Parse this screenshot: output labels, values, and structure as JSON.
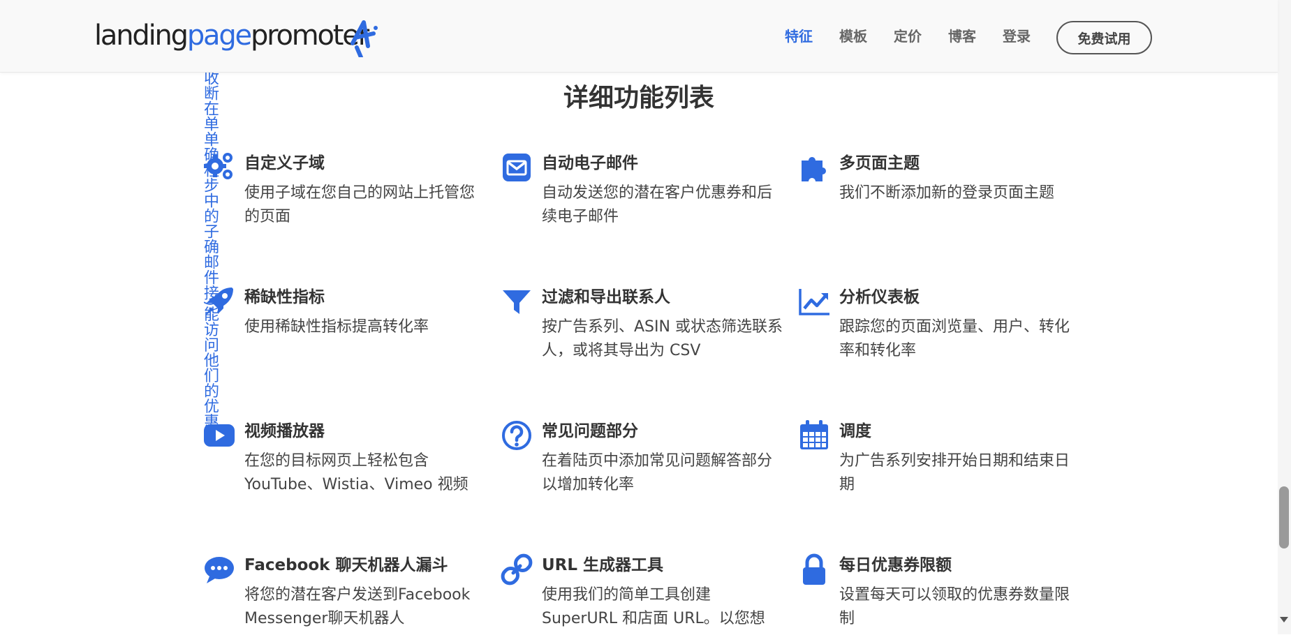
{
  "logo": {
    "part1": "landing",
    "part2": "page",
    "part3": "promoter"
  },
  "nav": [
    {
      "label": "特征",
      "active": true
    },
    {
      "label": "模板",
      "active": false
    },
    {
      "label": "定价",
      "active": false
    },
    {
      "label": "博客",
      "active": false
    },
    {
      "label": "登录",
      "active": false
    }
  ],
  "trial_button": "免费试用",
  "section_title": "详细功能列表",
  "overlap_text": "收断在单单确程步中的子确邮件接)能访问他们的优惠券",
  "features": [
    {
      "title": "自定义子域",
      "desc": "使用子域在您自己的网站上托管您的页面",
      "icon": "gears-icon"
    },
    {
      "title": "自动电子邮件",
      "desc": "自动发送您的潜在客户优惠券和后续电子邮件",
      "icon": "envelope-icon"
    },
    {
      "title": "多页面主题",
      "desc": "我们不断添加新的登录页面主题",
      "icon": "puzzle-icon"
    },
    {
      "title": "稀缺性指标",
      "desc": "使用稀缺性指标提高转化率",
      "icon": "rocket-icon"
    },
    {
      "title": "过滤和导出联系人",
      "desc": "按广告系列、ASIN 或状态筛选联系人，或将其导出为 CSV",
      "icon": "filter-icon"
    },
    {
      "title": "分析仪表板",
      "desc": "跟踪您的页面浏览量、用户、转化率和转化率",
      "icon": "chart-line-icon"
    },
    {
      "title": "视频播放器",
      "desc": "在您的目标网页上轻松包含 YouTube、Wistia、Vimeo 视频",
      "icon": "youtube-icon"
    },
    {
      "title": "常见问题部分",
      "desc": "在着陆页中添加常见问题解答部分以增加转化率",
      "icon": "question-circle-icon"
    },
    {
      "title": "调度",
      "desc": "为广告系列安排开始日期和结束日期",
      "icon": "calendar-icon"
    },
    {
      "title": "Facebook 聊天机器人漏斗",
      "desc": "将您的潜在客户发送到Facebook Messenger聊天机器人",
      "icon": "chat-icon"
    },
    {
      "title": "URL 生成器工具",
      "desc": "使用我们的简单工具创建 SuperURL 和店面 URL。以您想",
      "icon": "link-icon"
    },
    {
      "title": "每日优惠券限额",
      "desc": "设置每天可以领取的优惠券数量限制",
      "icon": "lock-icon"
    }
  ],
  "colors": {
    "accent": "#2f6be0",
    "text": "#333333"
  }
}
